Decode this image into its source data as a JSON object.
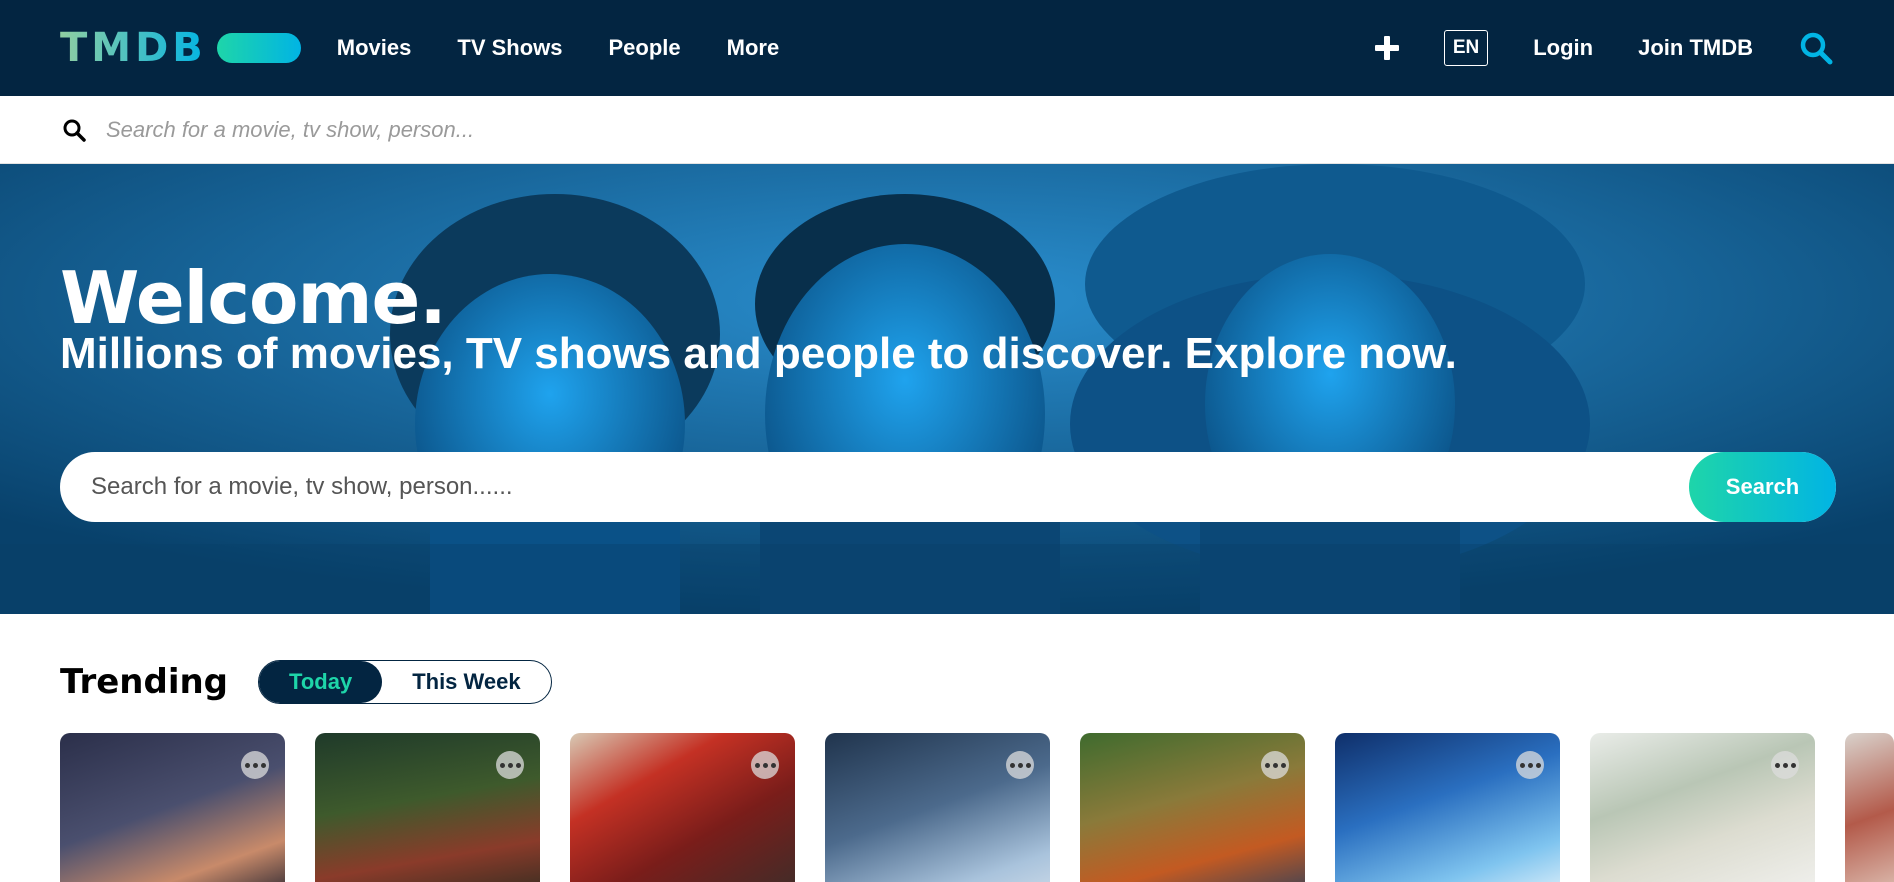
{
  "nav": {
    "logo": "TMDB",
    "menu": [
      "Movies",
      "TV Shows",
      "People",
      "More"
    ],
    "lang": "EN",
    "login": "Login",
    "join": "Join TMDB"
  },
  "subsearch": {
    "placeholder": "Search for a movie, tv show, person..."
  },
  "hero": {
    "title": "Welcome.",
    "subtitle": "Millions of movies, TV shows and people to discover. Explore now.",
    "search_placeholder": "Search for a movie, tv show, person......",
    "search_button": "Search"
  },
  "trending": {
    "title": "Trending",
    "options": [
      "Today",
      "This Week"
    ],
    "selected": "Today"
  },
  "colors": {
    "nav_bg": "#032541",
    "accent_green": "#1ed5a9",
    "accent_blue": "#01b4e4"
  },
  "icons": [
    "plus-icon",
    "search-icon",
    "more-options-icon"
  ]
}
